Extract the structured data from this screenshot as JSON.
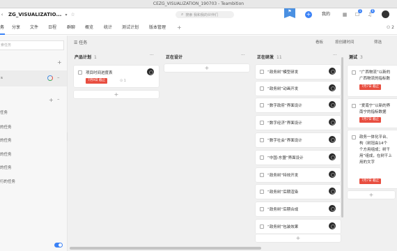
{
  "window": {
    "title": "CEZG_VISUALIZATION_190703 - Teambition"
  },
  "header": {
    "project_title": "ZG_VISUALIZATIO...",
    "search_placeholder": "搜索 我和我的伙伴们",
    "mine_label": "我的",
    "notif_badge": "1",
    "bell_badge": "0"
  },
  "tabs": [
    {
      "label": "分享"
    },
    {
      "label": "文件"
    },
    {
      "label": "日程"
    },
    {
      "label": "群聊"
    },
    {
      "label": "概览"
    },
    {
      "label": "统计"
    },
    {
      "label": "测试计划"
    },
    {
      "label": "版本管理"
    }
  ],
  "tabbar": {
    "first_tab": "务",
    "add": "+",
    "members": "⚇ 2"
  },
  "sidebar": {
    "search_placeholder": "索任务",
    "group_items": [
      "任务",
      "的任务",
      "的任务",
      "的任务",
      "的任务",
      "行的任务"
    ]
  },
  "board": {
    "title": "任务",
    "options": [
      "看板",
      "按创建时间",
      "筛选"
    ]
  },
  "columns": [
    {
      "title": "产品计划",
      "count": "1"
    },
    {
      "title": "正在设计",
      "count": ""
    },
    {
      "title": "正在研发",
      "count": "11"
    },
    {
      "title": "测试",
      "count": "3"
    }
  ],
  "plan_card": {
    "text": "项目时间进度表",
    "due": "7月9日 截止",
    "sub": "⊙ 1"
  },
  "dev_cards": [
    "“政务树”模型研发",
    "“政务树”动画开发",
    "“数字政府”界面设计",
    "“数字经济”界面设计",
    "“数字社会”界面设计",
    "“中国-东盟”界面设计",
    "“政务树”特效开发",
    "“政务树”后期渲染",
    "“政务树”后期合成",
    "“政务树”包装效果"
  ],
  "test_cards": [
    {
      "lines": [
        "“广西物流”以新的",
        "广西物流的指标数"
      ],
      "due": "7月7日 截止"
    },
    {
      "lines": [
        "“爱南宁”以新的界",
        "南宁的指标数据"
      ],
      "due": "7月7日 截止"
    },
    {
      "lines": [
        "政务一体化平台、",
        "构（树冠由14个",
        "个方用组成；树干",
        "用”组成，在树干上",
        "用的文字"
      ],
      "due": "7月7日 截止"
    }
  ],
  "add_symbol": "+"
}
